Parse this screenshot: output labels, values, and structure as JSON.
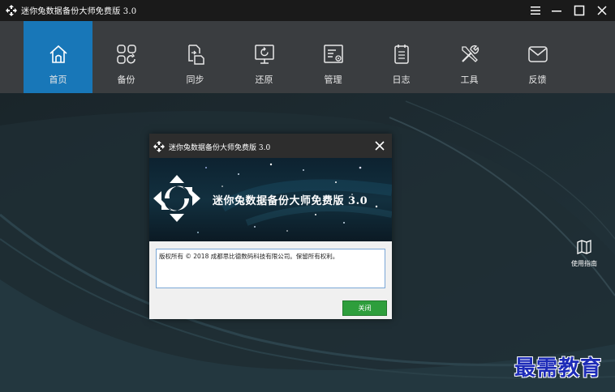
{
  "window": {
    "title": "迷你兔数据备份大师免费版 3.0",
    "controls": [
      "menu-icon",
      "minimize-icon",
      "maximize-icon",
      "close-icon"
    ]
  },
  "toolbar": {
    "items": [
      {
        "label": "首页",
        "icon": "home-icon",
        "active": true
      },
      {
        "label": "备份",
        "icon": "backup-icon",
        "active": false
      },
      {
        "label": "同步",
        "icon": "sync-icon",
        "active": false
      },
      {
        "label": "还原",
        "icon": "restore-icon",
        "active": false
      },
      {
        "label": "管理",
        "icon": "manage-icon",
        "active": false
      },
      {
        "label": "日志",
        "icon": "log-icon",
        "active": false
      },
      {
        "label": "工具",
        "icon": "tools-icon",
        "active": false
      },
      {
        "label": "反馈",
        "icon": "feedback-icon",
        "active": false
      }
    ]
  },
  "side": {
    "guide_label": "使用指南"
  },
  "dialog": {
    "title": "迷你兔数据备份大师免费版 3.0",
    "banner_title": "迷你兔数据备份大师免费版 3.0",
    "copyright": "版权所有 © 2018 成都思比德数码科技有限公司。保留所有权利。",
    "close_button": "关闭"
  },
  "watermark": "最需教育",
  "colors": {
    "titlebar": "#1a1a1a",
    "toolbar": "#3a3d40",
    "active_tab": "#1877b8",
    "background": "#1d2a30",
    "button_green": "#2e9e3c",
    "watermark": "#1d2bb8"
  }
}
